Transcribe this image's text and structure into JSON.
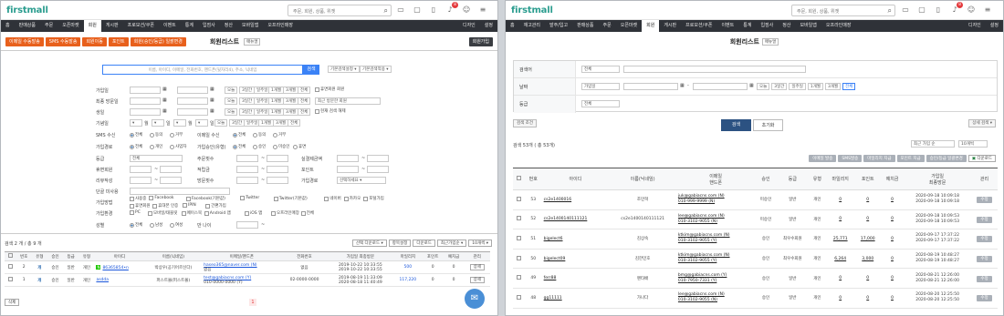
{
  "left": {
    "logo": "firstmall",
    "search_placeholder": "주문, 회원, 상품, 위젯",
    "badge_count": "8",
    "gnb": [
      "홈",
      "판매상품",
      "주문",
      "오픈마켓",
      "회원",
      "게시판",
      "프로모션/쿠폰",
      "이벤트",
      "통계",
      "입점사",
      "정산",
      "모바일앱",
      "오프라인매장"
    ],
    "gnb_badges": {
      "주문": "+",
      "회원": "+",
      "오픈마켓": "+",
      "게시판": "+"
    },
    "gnb_right": [
      "디자인",
      "설정"
    ],
    "tab_buttons": [
      "이메일 수동발송",
      "SMS 수동발송",
      "회원이동",
      "포인트",
      "회원(승인/등급) 일괄변경"
    ],
    "page_title": "회원리스트",
    "manual": "매뉴얼",
    "join_btn": "회원가입",
    "search_box_placeholder": "이름, 아이디, 이메일, 전화번호, 핸드폰(뒷자리4), 주소, 닉네임",
    "search_btn": "검색",
    "default_cond": "기본검색설정 ▾",
    "default_cond2": "기본검색적용 ▾",
    "labels": [
      "가입일",
      "최종 방문일",
      "생일",
      "기념일",
      "SMS 수신",
      "가입경로",
      "등급",
      "휴면회원",
      "리뷰작성",
      "단골 미사용",
      "가입방법",
      "가입환경",
      "성별"
    ],
    "date_chips": [
      "오늘",
      "3일간",
      "일주일",
      "1개월",
      "3개월",
      "전체"
    ],
    "chk_dormant": "휴면회원 회원",
    "visit_select": "최근 방문한 회원",
    "chk_notset": "현재 검색 해제",
    "month": "월",
    "day": "일",
    "sms_opts": [
      "전체",
      "동의",
      "거부"
    ],
    "email_label": "이메일 수신",
    "email_opts": [
      "전체",
      "동의",
      "거부"
    ],
    "route_opts": [
      "전체",
      "개인",
      "사업자"
    ],
    "approve_label": "가입승인(유형)",
    "approve_opts": [
      "전체",
      "승인",
      "미승인",
      "휴면"
    ],
    "grade_sel": "전체",
    "order_count": "주문횟수",
    "points_label": "실결제금액",
    "review_label": "상품후기",
    "point_label": "포인트",
    "reserve_label": "적립금",
    "visit_count": "방문횟수",
    "inflow_label": "가입경로",
    "inflow_sel": "선택하세요 ▾",
    "joinmethod": [
      "사용중",
      "Facebook",
      "Facebook(기본값)",
      "Twitter",
      "Twitter(기본값)",
      "네이버",
      "카카오",
      "포털가입"
    ],
    "joinmethod2": [
      "휴면회원",
      "휴대폰 인증",
      "IPIN",
      "간편가입"
    ],
    "env_opts": [
      "PC",
      "모바일/태블릿",
      "페이스북",
      "Android 앱",
      "iOS 앱",
      "오프라인매장",
      "전체"
    ],
    "gender_opts": [
      "전체",
      "남성",
      "여성"
    ],
    "age_label": "만 나이",
    "result_count": "검색 2 개 / 총 9 개",
    "tools": [
      "선택 다운로드 ▾",
      "항목설정",
      "다운로드",
      "최근가입순 ▾",
      "10개씩 ▾"
    ],
    "cols": [
      "번호",
      "유형",
      "승인",
      "등급",
      "유형",
      "아이디",
      "이름(닉네임)",
      "이메일/핸드폰",
      "전화번호",
      "가입일\n최종방문",
      "마일리지",
      "포인트",
      "예치금",
      "관리"
    ],
    "rows": [
      {
        "no": "2",
        "type": "개",
        "approve": "승인",
        "grade": "일반",
        "kind": "개인",
        "id": "86365854•n",
        "name": "박상우(공기어르신다)",
        "email": "haseo365@naver.com (N)",
        "phone2": "없음",
        "tel": "없음",
        "date": "2019-10-22 10:33:55",
        "date2": "2019-10-22 10:33:55",
        "mile": "500",
        "point": "0",
        "dep": "0",
        "mgr": "상세"
      },
      {
        "no": "1",
        "type": "개",
        "approve": "승인",
        "grade": "일반",
        "kind": "개인",
        "id": "asdda",
        "name": "퍼스트몰(퍼스트몰)",
        "email": "test@gabiacns.com (Y)",
        "phone2": "010-0000-0000 (Y)",
        "tel": "02-0000-0000",
        "date": "2019-08-19 11:33:09",
        "date2": "2020-08-18 11:40:49",
        "mile": "117,220",
        "point": "0",
        "dep": "0",
        "mgr": "상세"
      }
    ],
    "page": "1",
    "del_btn": "삭제"
  },
  "right": {
    "logo": "firstmall",
    "search_placeholder": "주문, 회원, 상품, 위젯",
    "badge_count": "8",
    "gnb": [
      "홈",
      "재고관리",
      "발주/입고",
      "판매상품",
      "주문",
      "오픈마켓",
      "회원",
      "게시판",
      "프로모션/쿠폰",
      "이벤트",
      "통계",
      "입점사",
      "정산",
      "모바일앱",
      "오프라인매장"
    ],
    "gnb_right": [
      "디자인",
      "설정"
    ],
    "page_title": "회원리스트",
    "manual": "매뉴얼",
    "f_search": "검색어",
    "f_search_sel": "전체",
    "f_date": "날짜",
    "f_date_sel": "가입일",
    "date_chips": [
      "오늘",
      "3일간",
      "일주일",
      "1개월",
      "3개월",
      "전체"
    ],
    "f_grade": "등급",
    "f_grade_sel": "전체",
    "cond_btn": "검색 조건",
    "search_btn": "검색",
    "reset_btn": "초기화",
    "detail_btn": "상세 검색 ▾",
    "result_count": "검색 53개 ( 총 53개)",
    "sort_sel": "최근 가입 순",
    "per_sel": "10개씩",
    "tools": [
      "이메일 발송",
      "SMS발송",
      "마일리지 지급",
      "포인트 지급",
      "승인/등급 일괄변경",
      "다운로드"
    ],
    "cols": [
      "번호",
      "아이디",
      "이름(닉네임)",
      "이메일\n핸드폰",
      "승인",
      "등급",
      "유형",
      "마일리지",
      "포인트",
      "예치금",
      "가입일\n최종방문",
      "관리"
    ],
    "rows": [
      {
        "no": "53",
        "id": "cs2e1400016",
        "name": "조민혁",
        "email": "juk@gabiacns.com (N)",
        "phone": "010-999-9999 (N)",
        "approve": "미승인",
        "grade": "일반",
        "kind": "개인",
        "mile": "0",
        "point": "0",
        "dep": "0",
        "date": "2020-09-18 10:09:18",
        "date2": "2020-09-18 10:09:18",
        "mgr": "수정"
      },
      {
        "no": "52",
        "id": "cs2e1400140111121",
        "name": "cs2e1400140111121",
        "email": "lee@gabiacns.com (N)",
        "phone": "010-3102-9055 (N)",
        "approve": "미승인",
        "grade": "일반",
        "kind": "개인",
        "mile": "0",
        "point": "0",
        "dep": "0",
        "date": "2020-09-18 10:09:53",
        "date2": "2020-09-18 10:09:53",
        "mgr": "수정"
      },
      {
        "no": "51",
        "id": "bigelect6",
        "name": "김상숙",
        "email": "ktkim@gabiacns.com (N)",
        "phone": "010-3102-9055 (Y)",
        "approve": "승인",
        "grade": "최우수회원",
        "kind": "개인",
        "mile": "25,771",
        "point": "17,000",
        "dep": "0",
        "date": "2020-09-17 17:37:22",
        "date2": "2020-09-17 17:37:22",
        "mgr": "수정"
      },
      {
        "no": "50",
        "id": "bigelect09",
        "name": "김한민호",
        "email": "ktkim@gabiacns.com (N)",
        "phone": "010-3102-9055 (Y)",
        "approve": "승인",
        "grade": "최우수회원",
        "kind": "개인",
        "mile": "6,264",
        "point": "3,000",
        "dep": "0",
        "date": "2020-08-19 10:48:27",
        "date2": "2020-08-19 10:48:27",
        "mgr": "수정"
      },
      {
        "no": "49",
        "id": "ferr88",
        "name": "펜타배",
        "email": "bmg@gabiacns.com (Y)",
        "phone": "010-7950-7331 (Y)",
        "approve": "승인",
        "grade": "일반",
        "kind": "개인",
        "mile": "0",
        "point": "0",
        "dep": "0",
        "date": "2020-08-21 12:26:00",
        "date2": "2020-08-21 12:26:00",
        "mgr": "수정"
      },
      {
        "no": "48",
        "id": "gg11111",
        "name": "가나다",
        "email": "lee@gabiacns.com (N)",
        "phone": "010-3102-9055 (N)",
        "approve": "승인",
        "grade": "일반",
        "kind": "개인",
        "mile": "0",
        "point": "0",
        "dep": "0",
        "date": "2020-08-20 12:25:50",
        "date2": "2020-08-20 12:25:50",
        "mgr": "수정"
      }
    ]
  }
}
